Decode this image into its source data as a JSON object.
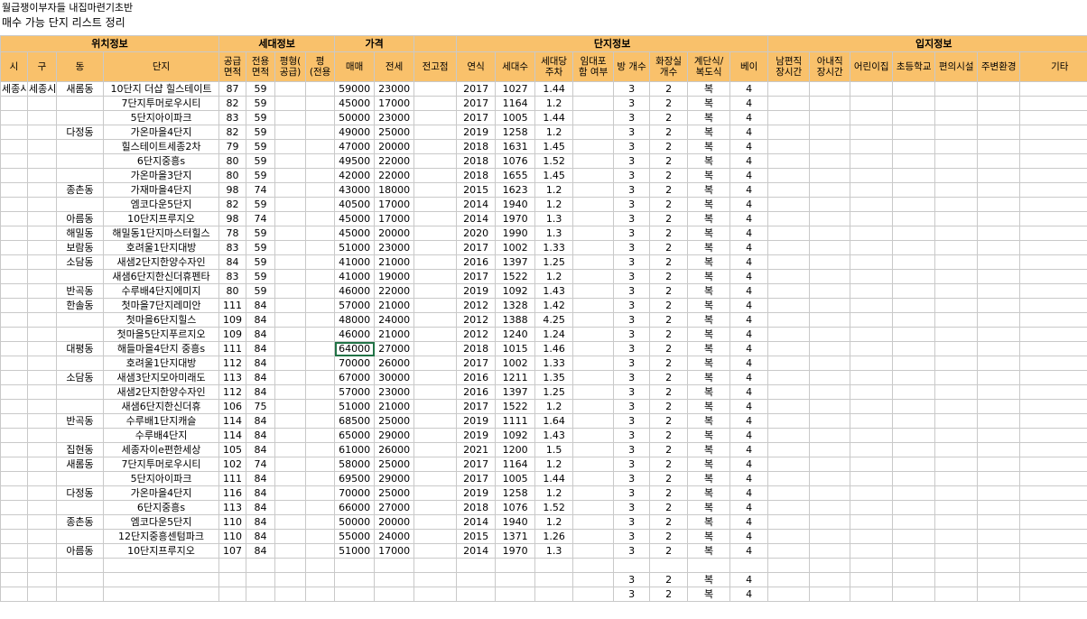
{
  "titles": {
    "line1": "월급쟁이부자들 내집마련기초반",
    "line2": "매수 가능 단지 리스트 정리"
  },
  "groups": [
    "위치정보",
    "세대정보",
    "가격",
    "",
    "단지정보",
    "입지정보"
  ],
  "columns": [
    "시",
    "구",
    "동",
    "단지",
    "공급\n면적",
    "전용\n면적",
    "평형(\n공급)",
    "평\n(전용",
    "매매",
    "전세",
    "전고점",
    "연식",
    "세대수",
    "세대당\n주차",
    "임대포\n함 여부",
    "방 개수",
    "화장실\n개수",
    "계단식/\n복도식",
    "베이",
    "남편직\n장시간",
    "아내직\n장시간",
    "어린이집",
    "초등학교",
    "편의시설",
    "주변환경",
    "기타"
  ],
  "rows": [
    [
      "세종시",
      "세종시",
      "새롬동",
      "10단지 더샵 힐스테이트",
      "87",
      "59",
      "",
      "",
      "59000",
      "23000",
      "",
      "2017",
      "1027",
      "1.44",
      "",
      "3",
      "2",
      "복",
      "4"
    ],
    [
      "",
      "",
      "",
      "7단지투머로우시티",
      "82",
      "59",
      "",
      "",
      "45000",
      "17000",
      "",
      "2017",
      "1164",
      "1.2",
      "",
      "3",
      "2",
      "복",
      "4"
    ],
    [
      "",
      "",
      "",
      "5단지아이파크",
      "83",
      "59",
      "",
      "",
      "50000",
      "23000",
      "",
      "2017",
      "1005",
      "1.44",
      "",
      "3",
      "2",
      "복",
      "4"
    ],
    [
      "",
      "",
      "다정동",
      "가온마을4단지",
      "82",
      "59",
      "",
      "",
      "49000",
      "25000",
      "",
      "2019",
      "1258",
      "1.2",
      "",
      "3",
      "2",
      "복",
      "4"
    ],
    [
      "",
      "",
      "",
      "힐스테이트세종2차",
      "79",
      "59",
      "",
      "",
      "47000",
      "20000",
      "",
      "2018",
      "1631",
      "1.45",
      "",
      "3",
      "2",
      "복",
      "4"
    ],
    [
      "",
      "",
      "",
      "6단지중흥s",
      "80",
      "59",
      "",
      "",
      "49500",
      "22000",
      "",
      "2018",
      "1076",
      "1.52",
      "",
      "3",
      "2",
      "복",
      "4"
    ],
    [
      "",
      "",
      "",
      "가온마을3단지",
      "80",
      "59",
      "",
      "",
      "42000",
      "22000",
      "",
      "2018",
      "1655",
      "1.45",
      "",
      "3",
      "2",
      "복",
      "4"
    ],
    [
      "",
      "",
      "종촌동",
      "가재마을4단지",
      "98",
      "74",
      "",
      "",
      "43000",
      "18000",
      "",
      "2015",
      "1623",
      "1.2",
      "",
      "3",
      "2",
      "복",
      "4"
    ],
    [
      "",
      "",
      "",
      "엠코다운5단지",
      "82",
      "59",
      "",
      "",
      "40500",
      "17000",
      "",
      "2014",
      "1940",
      "1.2",
      "",
      "3",
      "2",
      "복",
      "4"
    ],
    [
      "",
      "",
      "아름동",
      "10단지프루지오",
      "98",
      "74",
      "",
      "",
      "45000",
      "17000",
      "",
      "2014",
      "1970",
      "1.3",
      "",
      "3",
      "2",
      "복",
      "4"
    ],
    [
      "",
      "",
      "해밀동",
      "해밀동1단지마스터힐스",
      "78",
      "59",
      "",
      "",
      "45000",
      "20000",
      "",
      "2020",
      "1990",
      "1.3",
      "",
      "3",
      "2",
      "복",
      "4"
    ],
    [
      "",
      "",
      "보람동",
      "호려울1단지대방",
      "83",
      "59",
      "",
      "",
      "51000",
      "23000",
      "",
      "2017",
      "1002",
      "1.33",
      "",
      "3",
      "2",
      "복",
      "4"
    ],
    [
      "",
      "",
      "소담동",
      "새샘2단지한양수자인",
      "84",
      "59",
      "",
      "",
      "41000",
      "21000",
      "",
      "2016",
      "1397",
      "1.25",
      "",
      "3",
      "2",
      "복",
      "4"
    ],
    [
      "",
      "",
      "",
      "새샘6단지한신더휴펜타",
      "83",
      "59",
      "",
      "",
      "41000",
      "19000",
      "",
      "2017",
      "1522",
      "1.2",
      "",
      "3",
      "2",
      "복",
      "4"
    ],
    [
      "",
      "",
      "반곡동",
      "수루배4단지에미지",
      "80",
      "59",
      "",
      "",
      "46000",
      "22000",
      "",
      "2019",
      "1092",
      "1.43",
      "",
      "3",
      "2",
      "복",
      "4"
    ],
    [
      "",
      "",
      "한솔동",
      "첫마을7단지레미안",
      "111",
      "84",
      "",
      "",
      "57000",
      "21000",
      "",
      "2012",
      "1328",
      "1.42",
      "",
      "3",
      "2",
      "복",
      "4"
    ],
    [
      "",
      "",
      "",
      "첫마을6단지힐스",
      "109",
      "84",
      "",
      "",
      "48000",
      "24000",
      "",
      "2012",
      "1388",
      "4.25",
      "",
      "3",
      "2",
      "복",
      "4"
    ],
    [
      "",
      "",
      "",
      "첫마을5단지푸르지오",
      "109",
      "84",
      "",
      "",
      "46000",
      "21000",
      "",
      "2012",
      "1240",
      "1.24",
      "",
      "3",
      "2",
      "복",
      "4"
    ],
    [
      "",
      "",
      "대평동",
      "해들마을4단지 중흥s",
      "111",
      "84",
      "",
      "",
      "64000",
      "27000",
      "",
      "2018",
      "1015",
      "1.46",
      "",
      "3",
      "2",
      "복",
      "4"
    ],
    [
      "",
      "",
      "",
      "호려울1단지대방",
      "112",
      "84",
      "",
      "",
      "70000",
      "26000",
      "",
      "2017",
      "1002",
      "1.33",
      "",
      "3",
      "2",
      "복",
      "4"
    ],
    [
      "",
      "",
      "소담동",
      "새샘3단지모아미래도",
      "113",
      "84",
      "",
      "",
      "67000",
      "30000",
      "",
      "2016",
      "1211",
      "1.35",
      "",
      "3",
      "2",
      "복",
      "4"
    ],
    [
      "",
      "",
      "",
      "새샘2단지한양수자인",
      "112",
      "84",
      "",
      "",
      "57000",
      "23000",
      "",
      "2016",
      "1397",
      "1.25",
      "",
      "3",
      "2",
      "복",
      "4"
    ],
    [
      "",
      "",
      "",
      "새샘6단지한신더휴",
      "106",
      "75",
      "",
      "",
      "51000",
      "21000",
      "",
      "2017",
      "1522",
      "1.2",
      "",
      "3",
      "2",
      "복",
      "4"
    ],
    [
      "",
      "",
      "반곡동",
      "수루배1단지캐슬",
      "114",
      "84",
      "",
      "",
      "68500",
      "25000",
      "",
      "2019",
      "1111",
      "1.64",
      "",
      "3",
      "2",
      "복",
      "4"
    ],
    [
      "",
      "",
      "",
      "수루배4단지",
      "114",
      "84",
      "",
      "",
      "65000",
      "29000",
      "",
      "2019",
      "1092",
      "1.43",
      "",
      "3",
      "2",
      "복",
      "4"
    ],
    [
      "",
      "",
      "집현동",
      "세종자이e편한세상",
      "105",
      "84",
      "",
      "",
      "61000",
      "26000",
      "",
      "2021",
      "1200",
      "1.5",
      "",
      "3",
      "2",
      "복",
      "4"
    ],
    [
      "",
      "",
      "새롬동",
      "7단지투머로우시티",
      "102",
      "74",
      "",
      "",
      "58000",
      "25000",
      "",
      "2017",
      "1164",
      "1.2",
      "",
      "3",
      "2",
      "복",
      "4"
    ],
    [
      "",
      "",
      "",
      "5단지아이파크",
      "111",
      "84",
      "",
      "",
      "69500",
      "29000",
      "",
      "2017",
      "1005",
      "1.44",
      "",
      "3",
      "2",
      "복",
      "4"
    ],
    [
      "",
      "",
      "다정동",
      "가온마을4단지",
      "116",
      "84",
      "",
      "",
      "70000",
      "25000",
      "",
      "2019",
      "1258",
      "1.2",
      "",
      "3",
      "2",
      "복",
      "4"
    ],
    [
      "",
      "",
      "",
      "6단지중흥s",
      "113",
      "84",
      "",
      "",
      "66000",
      "27000",
      "",
      "2018",
      "1076",
      "1.52",
      "",
      "3",
      "2",
      "복",
      "4"
    ],
    [
      "",
      "",
      "종촌동",
      "엠코다운5단지",
      "110",
      "84",
      "",
      "",
      "50000",
      "20000",
      "",
      "2014",
      "1940",
      "1.2",
      "",
      "3",
      "2",
      "복",
      "4"
    ],
    [
      "",
      "",
      "",
      "12단지중흥센텀파크",
      "110",
      "84",
      "",
      "",
      "55000",
      "24000",
      "",
      "2015",
      "1371",
      "1.26",
      "",
      "3",
      "2",
      "복",
      "4"
    ],
    [
      "",
      "",
      "아름동",
      "10단지프루지오",
      "107",
      "84",
      "",
      "",
      "51000",
      "17000",
      "",
      "2014",
      "1970",
      "1.3",
      "",
      "3",
      "2",
      "복",
      "4"
    ],
    [
      "",
      "",
      "",
      "",
      "",
      "",
      "",
      "",
      "",
      "",
      "",
      "",
      "",
      "",
      "",
      "",
      "",
      "",
      ""
    ],
    [
      "",
      "",
      "",
      "",
      "",
      "",
      "",
      "",
      "",
      "",
      "",
      "",
      "",
      "",
      "",
      "3",
      "2",
      "복",
      "4"
    ],
    [
      "",
      "",
      "",
      "",
      "",
      "",
      "",
      "",
      "",
      "",
      "",
      "",
      "",
      "",
      "",
      "3",
      "2",
      "복",
      "4"
    ]
  ]
}
